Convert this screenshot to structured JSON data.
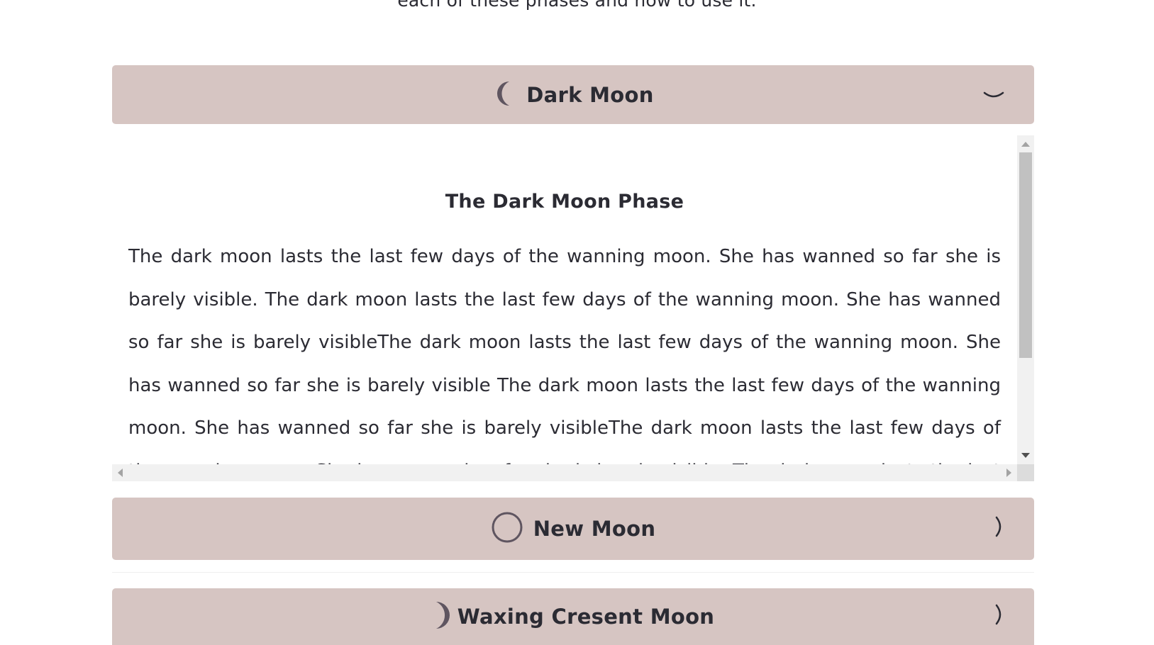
{
  "intro_text": "each of these phases and how to use it.",
  "accordion": {
    "items": [
      {
        "title": "Dark Moon",
        "icon": "crescent-thin-icon",
        "expanded": true,
        "chevron": "chevron-down-icon"
      },
      {
        "title": "New Moon",
        "icon": "circle-outline-icon",
        "expanded": false,
        "chevron": "chevron-right-icon"
      },
      {
        "title": "Waxing Cresent Moon",
        "icon": "waxing-crescent-icon",
        "expanded": false,
        "chevron": "chevron-right-icon"
      }
    ]
  },
  "panel": {
    "heading": "The Dark Moon Phase",
    "body": "The dark moon lasts the last few days of the wanning moon. She has wanned so far she is barely visible. The dark moon lasts the last few days of the wanning moon. She has wanned so far she is barely visibleThe dark moon lasts the last few days of the wanning moon. She has wanned so far she is barely visible The dark moon lasts the last few days of the wanning moon. She has wanned so far she is barely visibleThe dark moon lasts the last few days of the wanning moon. She has wanned so far she is barely visible. The dark moon lasts the last few days of the"
  },
  "colors": {
    "header_bg": "#d6c5c2",
    "text": "#2b2b33",
    "icon": "#5f5560"
  }
}
